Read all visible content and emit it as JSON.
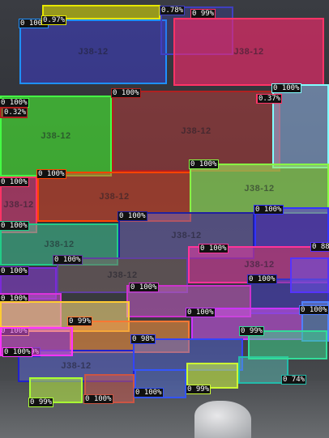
{
  "scene": {
    "description_colors": {
      "background": "#2e3035",
      "floor": "#5a5d60"
    },
    "print_text": "J38-12"
  },
  "detections": [
    {
      "label": "0 100%",
      "color": "#1e90ff",
      "fill": "rgba(60,60,200,0.55)"
    },
    {
      "label": "0.97%",
      "color": "#e6e600",
      "fill": "rgba(230,230,0,0.55)"
    },
    {
      "label": "0.78%",
      "color": "#4040c0",
      "fill": "rgba(60,60,200,0.25)"
    },
    {
      "label": "0 99%",
      "color": "#ff3366",
      "fill": "rgba(255,40,110,0.6)"
    },
    {
      "label": "0 100%",
      "color": "#44ff44",
      "fill": "rgba(70,230,50,0.65)"
    },
    {
      "label": "0 100%",
      "color": "#b02020",
      "fill": "rgba(180,60,60,0.55)"
    },
    {
      "label": "0 100%",
      "color": "#80ffff",
      "fill": "rgba(160,200,255,0.5)"
    },
    {
      "label": "0 100%",
      "color": "#ff3366",
      "fill": "rgba(220,60,120,0.6)"
    },
    {
      "label": "0 100%",
      "color": "#ff4400",
      "fill": "rgba(230,70,40,0.55)"
    },
    {
      "label": "0 100%",
      "color": "#88ff44",
      "fill": "rgba(150,230,90,0.65)"
    },
    {
      "label": "0 100%",
      "color": "#2020a0",
      "fill": "rgba(110,100,180,0.55)"
    },
    {
      "label": "0 100%",
      "color": "#22cc88",
      "fill": "rgba(60,200,150,0.55)"
    },
    {
      "label": "0 100%",
      "color": "#3333ff",
      "fill": "rgba(90,60,220,0.6)"
    },
    {
      "label": "0 100%",
      "color": "#7b2ad8",
      "fill": "rgba(140,60,220,0.55)"
    },
    {
      "label": "0 100%",
      "color": "#6040a0",
      "fill": "rgba(120,100,100,0.55)"
    },
    {
      "label": "0 100%",
      "color": "#ff3399",
      "fill": "rgba(220,60,160,0.6)"
    },
    {
      "label": "0 100%",
      "color": "#dd33dd",
      "fill": "rgba(200,80,200,0.55)"
    },
    {
      "label": "0 100%",
      "color": "#3333cc",
      "fill": "rgba(70,60,200,0.55)"
    },
    {
      "label": "0 100%",
      "color": "#cc33cc",
      "fill": "rgba(200,90,200,0.55)"
    },
    {
      "label": "0 100%",
      "color": "#ffcc33",
      "fill": "rgba(240,210,120,0.6)"
    },
    {
      "label": "0 100%",
      "color": "#cc33ff",
      "fill": "rgba(200,80,230,0.6)"
    },
    {
      "label": "0 100%",
      "color": "#5080ff",
      "fill": "rgba(110,150,230,0.5)"
    },
    {
      "label": "0 99%",
      "color": "#ff7733",
      "fill": "rgba(240,140,60,0.6)"
    },
    {
      "label": "0 99%",
      "color": "#2222cc",
      "fill": "rgba(90,100,210,0.55)"
    },
    {
      "label": "0 98%",
      "color": "#3344ff",
      "fill": "rgba(80,100,230,0.45)"
    },
    {
      "label": "0 99%",
      "color": "#aaff33",
      "fill": "rgba(180,230,70,0.6)"
    },
    {
      "label": "0 74%",
      "color": "#22bbaa",
      "fill": "rgba(90,200,190,0.45)"
    },
    {
      "label": "0 99%",
      "color": "#ccff33",
      "fill": "rgba(200,240,70,0.6)"
    },
    {
      "label": "0 100%",
      "color": "#cc5544",
      "fill": "rgba(200,90,80,0.55)"
    },
    {
      "label": "0 100%",
      "color": "#3355ff",
      "fill": "rgba(80,110,230,0.45)"
    },
    {
      "label": "0 99%",
      "color": "#33dd99",
      "fill": "rgba(60,210,140,0.55)"
    },
    {
      "label": "0 100%",
      "color": "#ff33ff",
      "fill": "rgba(220,80,220,0.55)"
    },
    {
      "label": "0 88",
      "color": "#5533ff",
      "fill": "rgba(110,80,230,0.55)"
    },
    {
      "label": "0.32%",
      "color": "#b02020",
      "fill": "rgba(0,0,0,0)"
    },
    {
      "label": "0.37%",
      "color": "#ff3366",
      "fill": "rgba(0,0,0,0)"
    }
  ]
}
